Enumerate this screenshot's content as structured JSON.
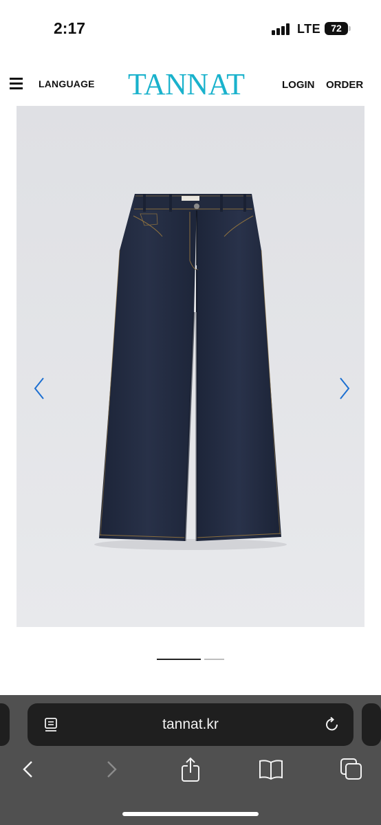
{
  "status_bar": {
    "time": "2:17",
    "carrier": "LTE",
    "battery": "72"
  },
  "header": {
    "language_label": "LANGUAGE",
    "logo_text": "TANNAT",
    "login_label": "LOGIN",
    "order_label": "ORDER",
    "logo_color": "#1ab2cc"
  },
  "gallery": {
    "product": "dark indigo wide-leg denim jeans",
    "background_color": "#e3e4e8",
    "arrow_color": "#1c6fd1",
    "slide_count": 2,
    "current_slide": 1
  },
  "browser": {
    "url": "tannat.kr",
    "icons": [
      "reader-icon",
      "reload-icon",
      "back-icon",
      "forward-icon",
      "share-icon",
      "bookmarks-icon",
      "tabs-icon"
    ]
  }
}
